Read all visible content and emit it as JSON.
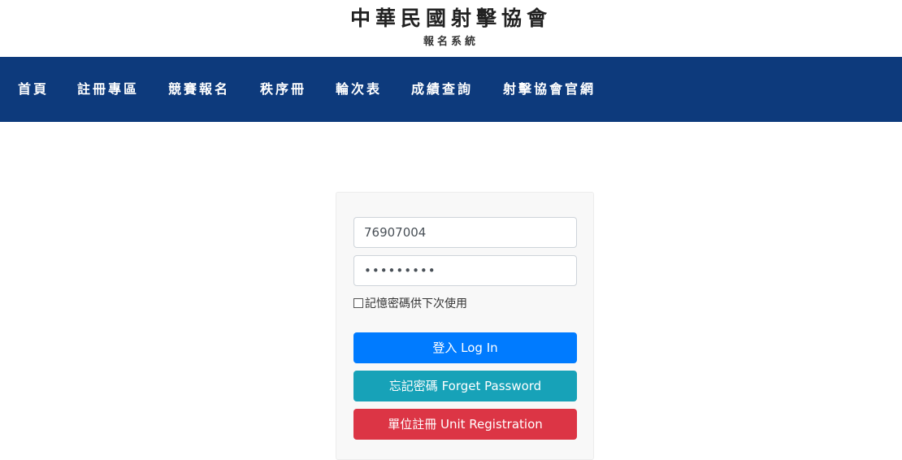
{
  "header": {
    "title": "中華民國射擊協會",
    "subtitle": "報名系統"
  },
  "nav": {
    "items": [
      {
        "label": "首頁"
      },
      {
        "label": "註冊專區"
      },
      {
        "label": "競賽報名"
      },
      {
        "label": "秩序冊"
      },
      {
        "label": "輪次表"
      },
      {
        "label": "成績查詢"
      },
      {
        "label": "射擊協會官網"
      }
    ]
  },
  "login": {
    "username_value": "76907004",
    "password_value": "•••••••••",
    "remember_label": "記憶密碼供下次使用",
    "remember_checked": false,
    "login_button": "登入 Log In",
    "forget_button": "忘記密碼 Forget Password",
    "register_button": "單位註冊 Unit Registration"
  },
  "colors": {
    "nav_background": "#0d3a7c",
    "login_button": "#007bff",
    "forget_button": "#17a2b8",
    "register_button": "#dc3545"
  }
}
